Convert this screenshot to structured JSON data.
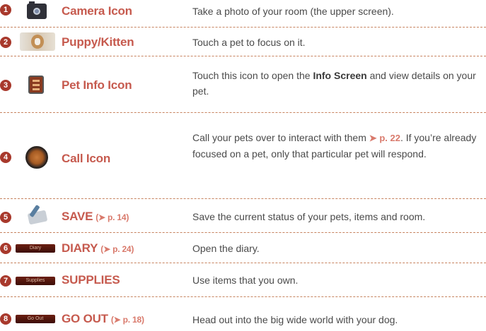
{
  "rows": [
    {
      "num": "1",
      "name": "Camera Icon",
      "ref": "",
      "desc": "Take a photo of your room (the upper screen)."
    },
    {
      "num": "2",
      "name": "Puppy/Kitten",
      "ref": "",
      "desc": "Touch a pet to focus on it."
    },
    {
      "num": "3",
      "name": "Pet Info Icon",
      "ref": "",
      "desc_pre": "Touch this icon to open the ",
      "desc_bold": "Info Screen",
      "desc_post": " and view details on your pet."
    },
    {
      "num": "4",
      "name": "Call Icon",
      "ref": "",
      "desc_pre": "Call your pets over to interact with them ",
      "desc_ref": "p. 22",
      "desc_post": ". If you’re already focused on a pet, only that particular pet will respond."
    },
    {
      "num": "5",
      "name": "SAVE",
      "ref": "p. 14",
      "desc": "Save the current status of your pets, items and room."
    },
    {
      "num": "6",
      "name": "DIARY",
      "ref": "p. 24",
      "icon_text": "Diary",
      "desc": "Open the diary."
    },
    {
      "num": "7",
      "name": "SUPPLIES",
      "ref": "",
      "icon_text": "Supplies",
      "desc": "Use items that you own."
    },
    {
      "num": "8",
      "name": "GO OUT",
      "ref": "p. 18",
      "icon_text": "Go Out",
      "desc": "Head out into the big wide world with your dog."
    }
  ],
  "arrow_glyph": "➤",
  "colors": {
    "accent": "#c65a4e",
    "badge": "#a8392c",
    "divider": "#c7835f",
    "text": "#4a4a4a"
  }
}
